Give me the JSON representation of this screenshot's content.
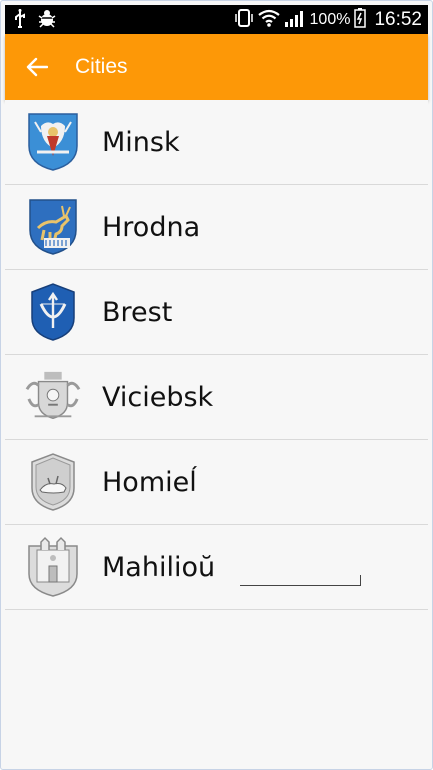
{
  "status": {
    "battery_percent": "100%",
    "time": "16:52"
  },
  "appbar": {
    "title": "Cities"
  },
  "cities": [
    {
      "name": "Minsk",
      "emblem": "minsk-coat-of-arms"
    },
    {
      "name": "Hrodna",
      "emblem": "hrodna-coat-of-arms"
    },
    {
      "name": "Brest",
      "emblem": "brest-coat-of-arms"
    },
    {
      "name": "Viciebsk",
      "emblem": "viciebsk-coat-of-arms"
    },
    {
      "name": "Homieĺ",
      "emblem": "homiel-coat-of-arms"
    },
    {
      "name": "Mahilioŭ",
      "emblem": "mahiliou-coat-of-arms"
    }
  ],
  "colors": {
    "appbar": "#fd9807",
    "status_bar": "#000000",
    "list_background": "#f7f7f7"
  }
}
